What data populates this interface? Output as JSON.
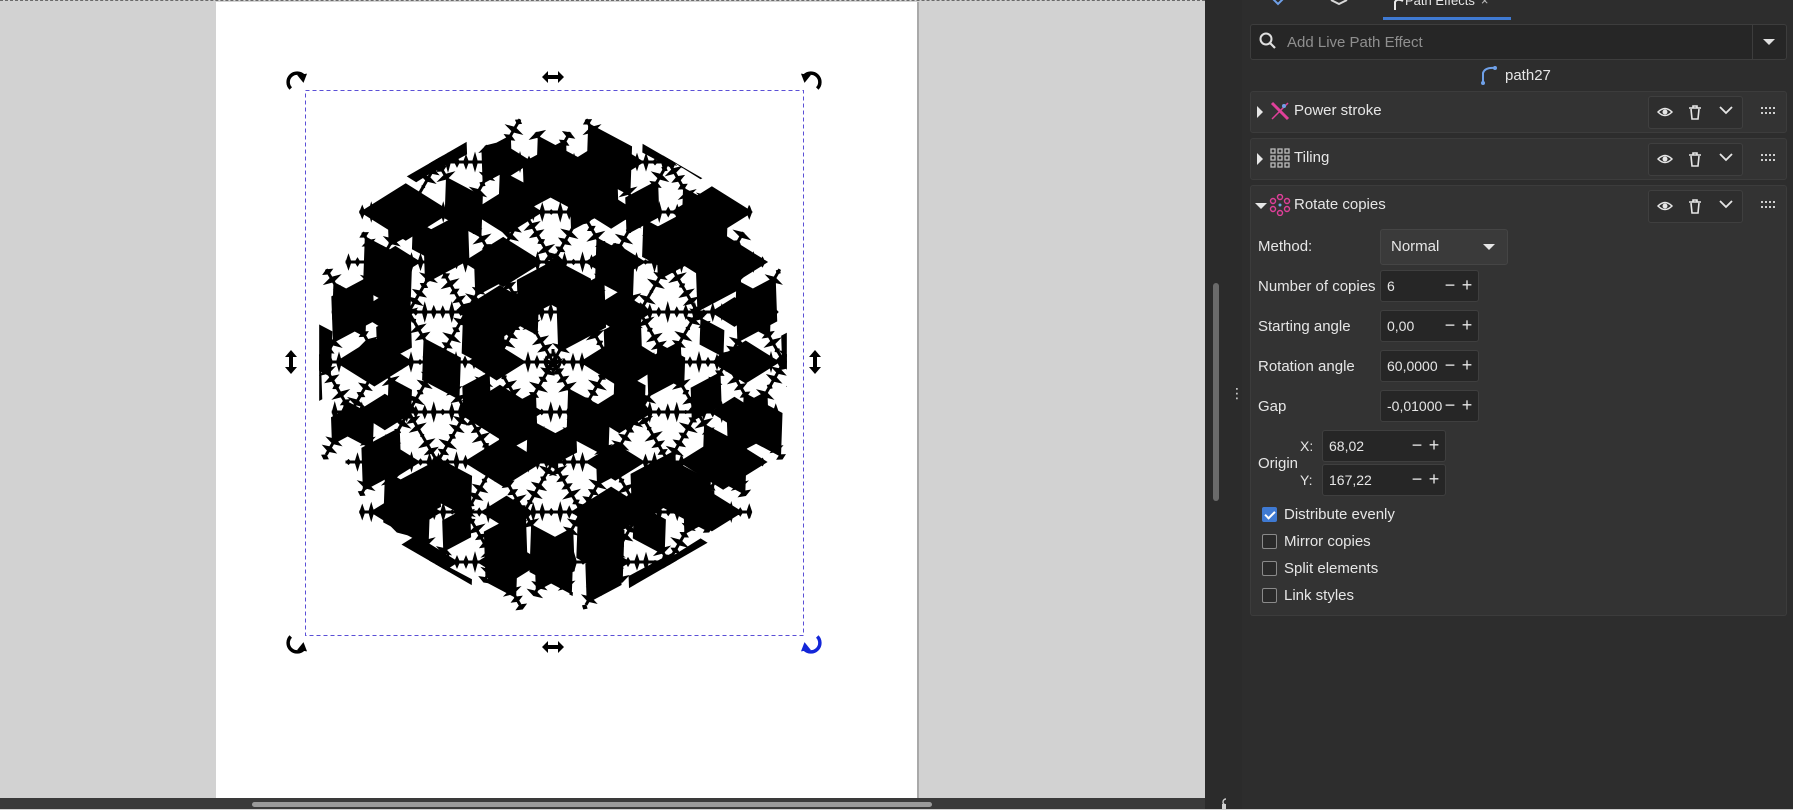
{
  "canvas": {
    "selection_color": "#5a4fd6",
    "active_handle_color": "#1326d8"
  },
  "dock": {
    "tabs": [
      {
        "label": "",
        "icon": "fill-stroke-icon"
      },
      {
        "label": "",
        "icon": "layers-icon"
      },
      {
        "label": "Path Effects",
        "close": "×",
        "icon": "path-effect-icon"
      }
    ]
  },
  "path_effects": {
    "search_placeholder": "Add Live Path Effect",
    "object_name": "path27",
    "effects": [
      {
        "name": "Power stroke",
        "expanded": false,
        "icon": "power-stroke-icon"
      },
      {
        "name": "Tiling",
        "expanded": false,
        "icon": "tiling-icon"
      },
      {
        "name": "Rotate copies",
        "expanded": true,
        "icon": "rotate-copies-icon"
      }
    ],
    "rotate_copies": {
      "method_label": "Method:",
      "method_value": "Normal",
      "copies_label": "Number of copies",
      "copies_value": "6",
      "start_angle_label": "Starting angle",
      "start_angle_value": "0,00",
      "rotation_angle_label": "Rotation angle",
      "rotation_angle_value": "60,0000",
      "gap_label": "Gap",
      "gap_value": "-0,01000",
      "origin_label": "Origin",
      "origin_x_label": "X:",
      "origin_x_value": "68,02",
      "origin_y_label": "Y:",
      "origin_y_value": "167,22",
      "distribute_label": "Distribute evenly",
      "distribute_checked": true,
      "mirror_label": "Mirror copies",
      "mirror_checked": false,
      "split_label": "Split elements",
      "split_checked": false,
      "link_label": "Link styles",
      "link_checked": false
    },
    "accent_color": "#3f7ad3",
    "icon_color": "#e0409a"
  }
}
